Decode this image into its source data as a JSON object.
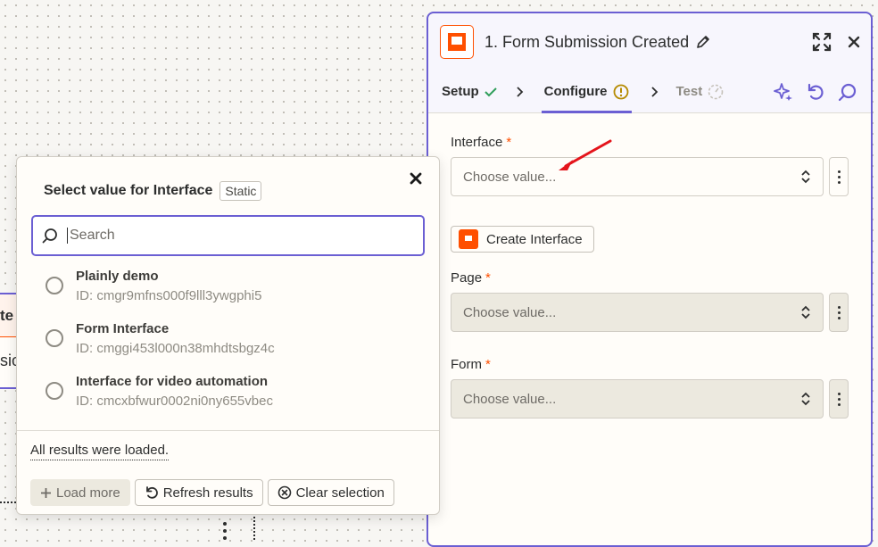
{
  "panel": {
    "title": "1. Form Submission Created",
    "tabs": [
      {
        "label": "Setup",
        "status": "check"
      },
      {
        "label": "Configure",
        "status": "warning"
      },
      {
        "label": "Test",
        "status": "pending"
      }
    ],
    "fields": {
      "interface": {
        "label": "Interface",
        "required": "*",
        "placeholder": "Choose value..."
      },
      "create_button": "Create Interface",
      "page": {
        "label": "Page",
        "required": "*",
        "placeholder": "Choose value..."
      },
      "form": {
        "label": "Form",
        "required": "*",
        "placeholder": "Choose value..."
      }
    }
  },
  "popover": {
    "title": "Select value for Interface",
    "badge": "Static",
    "search_placeholder": "Search",
    "options": [
      {
        "name": "Plainly demo",
        "id": "ID: cmgr9mfns000f9lll3ywgphi5"
      },
      {
        "name": "Form Interface",
        "id": "ID: cmggi453l000n38mhdtsbgz4c"
      },
      {
        "name": "Interface for video automation",
        "id": "ID: cmcxbfwur0002ni0ny655vbec"
      }
    ],
    "status": "All results were loaded.",
    "buttons": {
      "load_more": "Load more",
      "refresh": "Refresh results",
      "clear": "Clear selection"
    }
  },
  "background": {
    "node_top_text": "te",
    "node_bottom_text": "sio"
  },
  "colors": {
    "accent": "#6b5fd3",
    "brand": "#ff4f00",
    "success": "#2f9e5a",
    "warning": "#b58a00",
    "annotation_arrow": "#e4141b"
  }
}
